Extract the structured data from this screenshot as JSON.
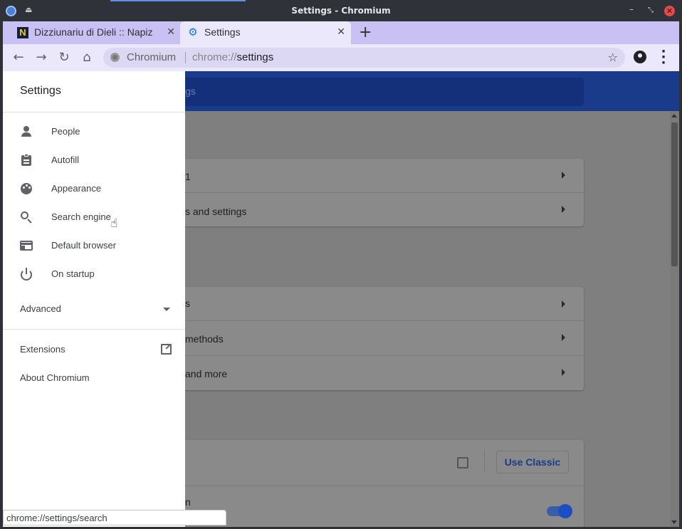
{
  "window": {
    "title": "Settings - Chromium"
  },
  "tabs": [
    {
      "label": "Dizziunariu di Dieli :: Napiz",
      "favicon": "N",
      "active": false
    },
    {
      "label": "Settings",
      "favicon": "gear-icon",
      "active": true
    }
  ],
  "omnibox": {
    "site_name": "Chromium",
    "url_scheme": "chrome://",
    "url_path": "settings"
  },
  "page": {
    "search_placeholder": "gs",
    "card1_rows": [
      "1",
      "s and settings"
    ],
    "card2_rows": [
      "s",
      "methods",
      "and more"
    ],
    "card3": {
      "row2_text": "n",
      "use_classic_label": "Use Classic",
      "toggle_on": true
    }
  },
  "drawer": {
    "title": "Settings",
    "items": [
      {
        "label": "People",
        "icon": "person-icon"
      },
      {
        "label": "Autofill",
        "icon": "clipboard-icon"
      },
      {
        "label": "Appearance",
        "icon": "palette-icon"
      },
      {
        "label": "Search engine",
        "icon": "search-icon"
      },
      {
        "label": "Default browser",
        "icon": "browser-icon"
      },
      {
        "label": "On startup",
        "icon": "power-icon"
      }
    ],
    "advanced_label": "Advanced",
    "extensions_label": "Extensions",
    "about_label": "About Chromium"
  },
  "status_bar": {
    "text": "chrome://settings/search"
  },
  "colors": {
    "tab_strip": "#c9c1f4",
    "toolbar": "#ebe8fb",
    "header_blue": "#1a3a8a",
    "accent_blue": "#1a73e8"
  }
}
